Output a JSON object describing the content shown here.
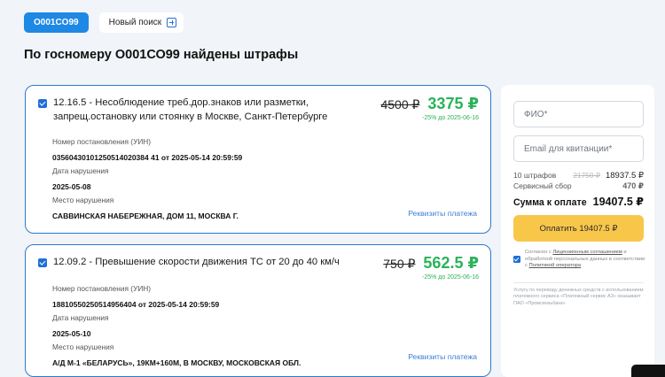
{
  "header": {
    "plate": "O001CO99",
    "new_search_label": "Новый поиск",
    "new_search_icon": "plus-square-icon"
  },
  "page_title": "По госномеру О001СО99 найдены штрафы",
  "fines": [
    {
      "title": "12.16.5 - Несоблюдение треб.дор.знаков или разметки, запрещ.остановку или стоянку в Москве, Санкт-Петербурге",
      "old_price": "4500 ₽",
      "new_price": "3375 ₽",
      "discount_note": "-25% до 2025-06-16",
      "uin_label": "Номер постановления (УИН)",
      "uin_value": "03560430101250514020384 41 от 2025-05-14 20:59:59",
      "date_label": "Дата нарушения",
      "date_value": "2025-05-08",
      "place_label": "Место нарушения",
      "place_value": "САВВИНСКАЯ НАБЕРЕЖНАЯ, ДОМ 11, МОСКВА Г.",
      "requisites_link": "Реквизиты платежа"
    },
    {
      "title": "12.09.2 - Превышение скорости движения ТС от 20 до 40 км/ч",
      "old_price": "750 ₽",
      "new_price": "562.5 ₽",
      "discount_note": "-25% до 2025-06-16",
      "uin_label": "Номер постановления (УИН)",
      "uin_value": "18810550250514956404 от 2025-05-14 20:59:59",
      "date_label": "Дата нарушения",
      "date_value": "2025-05-10",
      "place_label": "Место нарушения",
      "place_value": "А/Д М-1 «БЕЛАРУСЬ», 19КМ+160М, В МОСКВУ, МОСКОВСКАЯ ОБЛ.",
      "requisites_link": "Реквизиты платежа"
    }
  ],
  "sidebar": {
    "name_placeholder": "ФИО*",
    "email_placeholder": "Email для квитанции*",
    "count_label": "10 штрафов",
    "count_old": "21750 ₽",
    "count_value": "18937.5 ₽",
    "service_label": "Сервисный сбор",
    "service_value": "470 ₽",
    "total_label": "Сумма к оплате",
    "total_value": "19407.5 ₽",
    "pay_button": "Оплатить 19407.5 ₽",
    "consent_prefix": "Согласен с ",
    "consent_link1": "Лицензионным соглашением",
    "consent_mid": " и обработкой персональных данных в соответствии с ",
    "consent_link2": "Политикой оператора",
    "footnote": "Услугу по переводу денежных средств с использованием платежного сервиса «Платежный сервис А3» оказывает ПАО «Промсвязьбанк»"
  },
  "colors": {
    "accent": "#1e88e5",
    "card_border": "#2f79c8",
    "price_green": "#2bb25a",
    "pay_button": "#f8c74a"
  }
}
